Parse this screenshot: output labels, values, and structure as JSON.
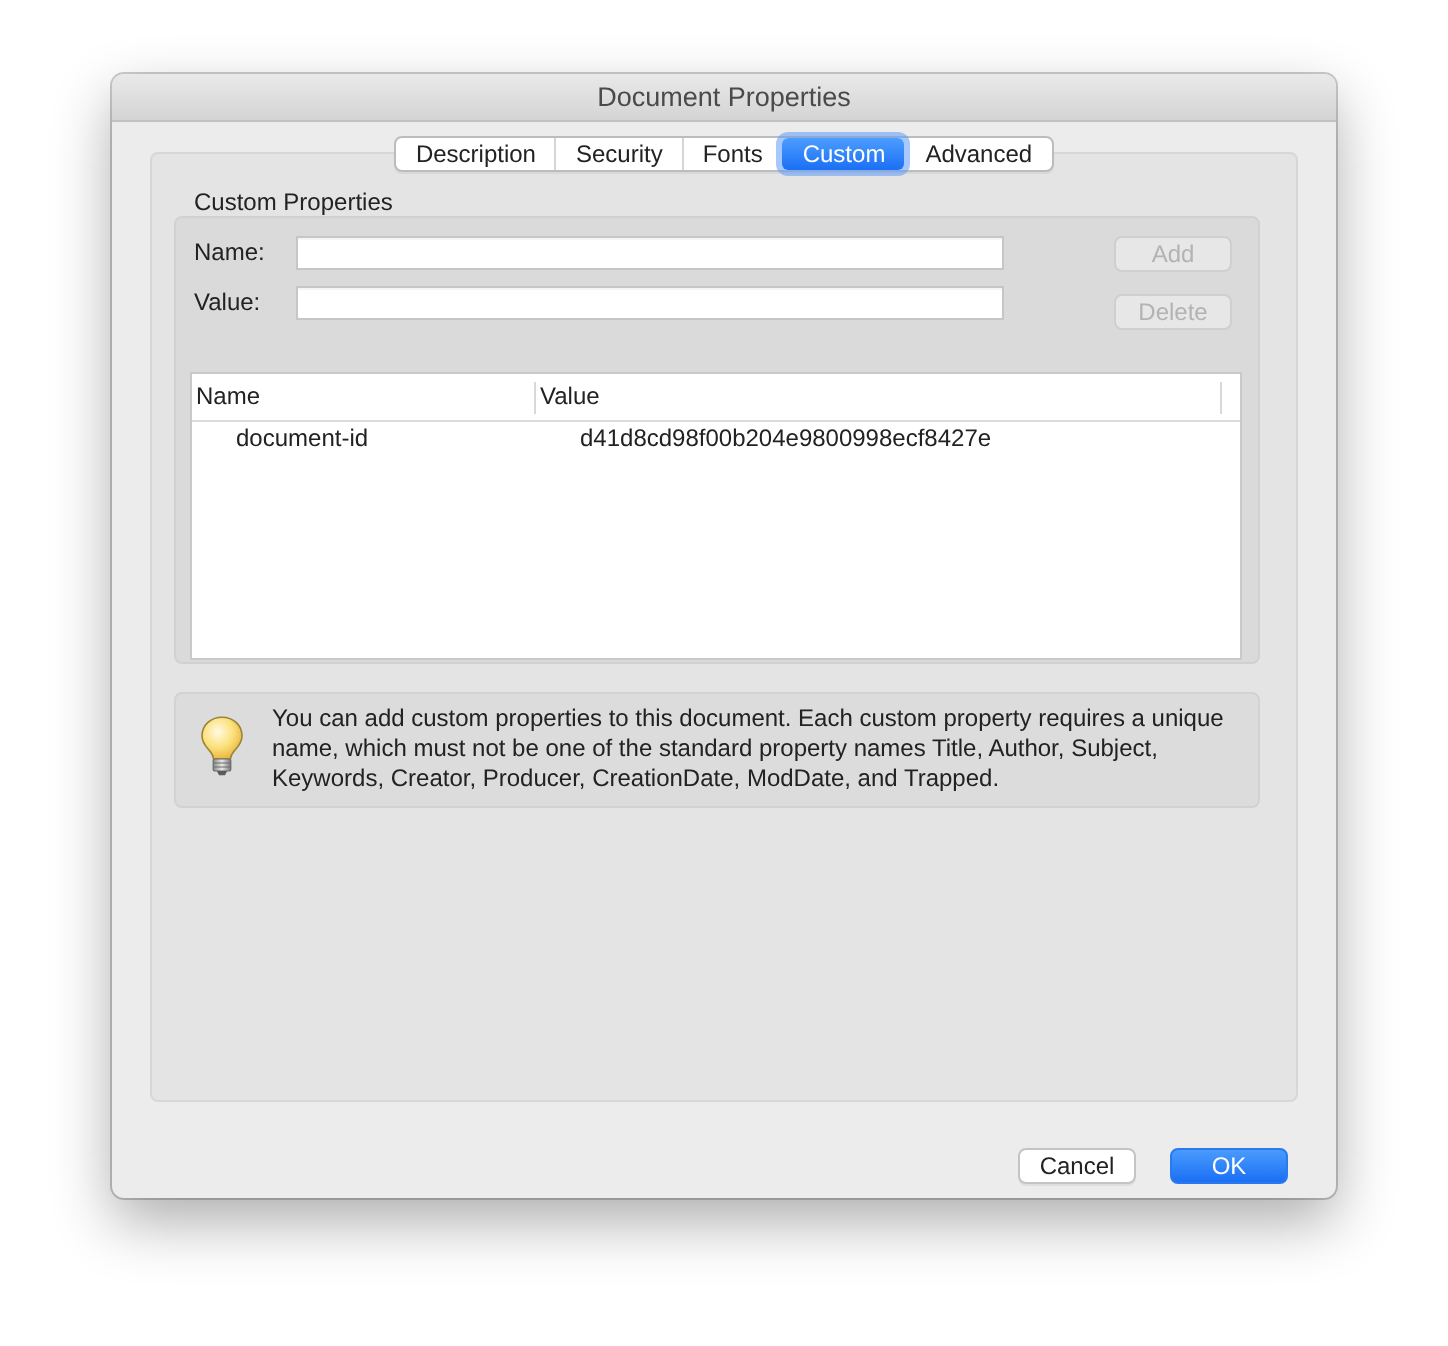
{
  "window": {
    "title": "Document Properties"
  },
  "tabs": [
    {
      "label": "Description",
      "selected": false
    },
    {
      "label": "Security",
      "selected": false
    },
    {
      "label": "Fonts",
      "selected": false
    },
    {
      "label": "Custom",
      "selected": true
    },
    {
      "label": "Advanced",
      "selected": false
    }
  ],
  "custom_properties": {
    "title": "Custom Properties",
    "fields": [
      {
        "label": "Name:"
      },
      {
        "label": "Value:"
      }
    ],
    "buttons": [
      {
        "label": "Add",
        "disabled": true
      },
      {
        "label": "Delete",
        "disabled": true
      }
    ],
    "table": {
      "columns": [
        "Name",
        "Value"
      ],
      "rows": [
        [
          "document-id",
          "d41d8cd98f00b204e9800998ecf8427e"
        ]
      ]
    }
  },
  "note": {
    "text": "You can add custom properties to this document. Each custom property requires a unique name, which must not be one of the standard property names Title, Author, Subject, Keywords, Creator, Producer, CreationDate, ModDate, and Trapped."
  },
  "buttons": [
    {
      "label": "Cancel",
      "default": false
    },
    {
      "label": "OK",
      "default": true
    }
  ]
}
